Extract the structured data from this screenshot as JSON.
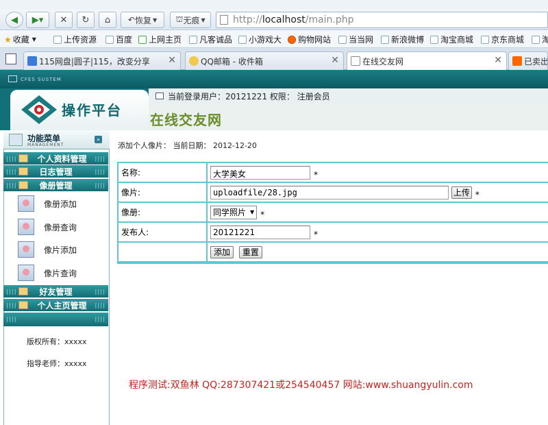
{
  "browser": {
    "address": {
      "prefix": "http://",
      "host": "localhost",
      "path": "/main.php"
    },
    "nav": {
      "restore_label": "恢复",
      "notrace_label": "无痕"
    },
    "bookmarks": [
      "收藏",
      "上传资源",
      "百度",
      "上网主页",
      "凡客诚品",
      "小游戏大",
      "购物网站",
      "当当网",
      "新浪微博",
      "淘宝商城",
      "京东商城",
      "淘"
    ],
    "tabs": [
      {
        "title": "115网盘|圆子|115，改变分享",
        "active": false
      },
      {
        "title": "QQ邮箱 - 收件箱",
        "active": false
      },
      {
        "title": "在线交友网",
        "active": true
      },
      {
        "title": "已卖出",
        "active": false
      }
    ]
  },
  "app": {
    "system_label": "CFES SUSTEM",
    "logo_text": "操作平台",
    "user_bar": "当前登录用户：20121221  权限：  注册会员",
    "site_title": "在线交友网"
  },
  "sidebar": {
    "title": "功能菜单",
    "subtitle": "MANAGEMENT",
    "menus": [
      "个人资料管理",
      "日志管理",
      "像册管理",
      "好友管理",
      "个人主页管理"
    ],
    "album_items": [
      "像册添加",
      "像册查询",
      "像片添加",
      "像片查询"
    ],
    "copyright": "版权所有：xxxxx",
    "advisor": "指导老师：xxxxx"
  },
  "content": {
    "heading": "添加个人像片：  当前日期：  2012-12-20",
    "form": {
      "name_label": "名称:",
      "name_value": "大学美女",
      "photo_label": "像片:",
      "photo_value": "uploadfile/28.jpg",
      "upload_button": "上传",
      "album_label": "像册:",
      "album_selected": "同学照片",
      "publisher_label": "发布人:",
      "publisher_value": "20121221",
      "required_mark": "*",
      "submit_button": "添加",
      "reset_button": "重置"
    }
  },
  "footer_note": "程序测试:双鱼林 QQ:287307421或254540457 网站:www.shuangyulin.com",
  "colors": {
    "teal": "#117078",
    "table_border": "#5dc7d3",
    "note_red": "#c7221e",
    "site_title_green": "#6a8e2a"
  }
}
